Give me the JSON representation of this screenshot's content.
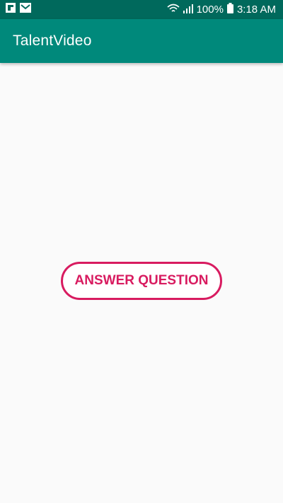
{
  "status_bar": {
    "battery_percent": "100%",
    "time": "3:18 AM",
    "icons": [
      "flipboard-icon",
      "mail-icon",
      "wifi-icon",
      "signal-icon",
      "battery-icon"
    ]
  },
  "app_bar": {
    "title": "TalentVideo"
  },
  "main": {
    "answer_button_label": "ANSWER QUESTION"
  },
  "colors": {
    "status_bar": "#00695c",
    "app_bar": "#00897b",
    "accent": "#d81b60",
    "background": "#fafafa"
  }
}
